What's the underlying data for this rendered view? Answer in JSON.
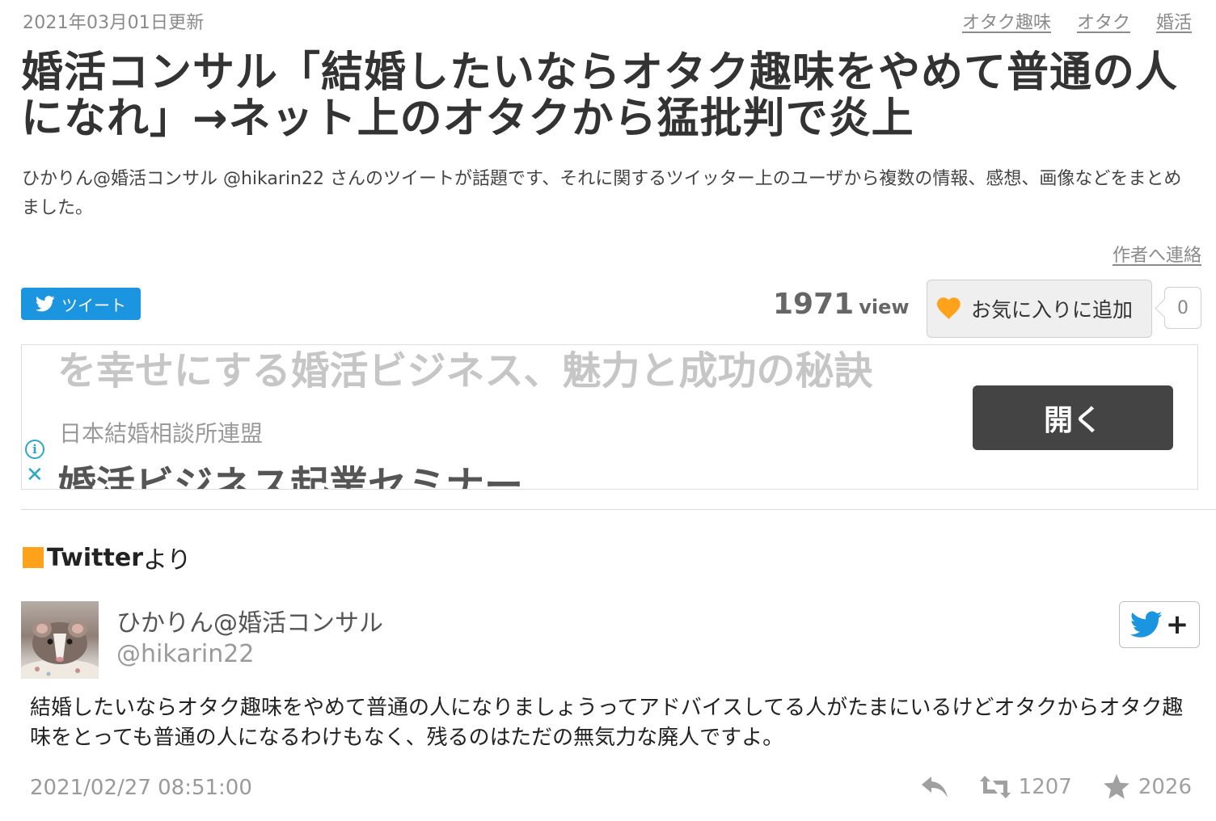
{
  "meta": {
    "updated": "2021年03月01日更新",
    "tags": [
      "オタク趣味",
      "オタク",
      "婚活"
    ]
  },
  "article": {
    "title": "婚活コンサル「結婚したいならオタク趣味をやめて普通の人になれ」→ネット上のオタクから猛批判で炎上",
    "lead": "ひかりん@婚活コンサル @hikarin22 さんのツイートが話題です、それに関するツイッター上のユーザから複数の情報、感想、画像などをまとめました。",
    "contact_label": "作者へ連絡"
  },
  "share": {
    "tweet_label": "ツイート",
    "views": "1971",
    "views_unit": "view",
    "favorite_label": "お気に入りに追加",
    "favorite_count": "0"
  },
  "ad": {
    "top_text": "を幸せにする婚活ビジネス、魅力と成功の秘訣",
    "sponsor": "日本結婚相談所連盟",
    "headline": "婚活ビジネス起業セミナー",
    "open_label": "開く",
    "info_glyph": "i",
    "close_glyph": "✕"
  },
  "section": {
    "title_bold": "Twitter",
    "title_rest": "より",
    "accent_color": "#ffa21b"
  },
  "tweet": {
    "name": "ひかりん@婚活コンサル",
    "handle": "@hikarin22",
    "follow_plus": "+",
    "body": "結婚したいならオタク趣味をやめて普通の人になりましょうってアドバイスしてる人がたまにいるけどオタクからオタク趣味をとっても普通の人になるわけもなく、残るのはただの無気力な廃人ですよ。",
    "date": "2021/02/27 08:51:00",
    "retweets": "1207",
    "likes": "2026",
    "twitter_color": "#1b95e0"
  }
}
